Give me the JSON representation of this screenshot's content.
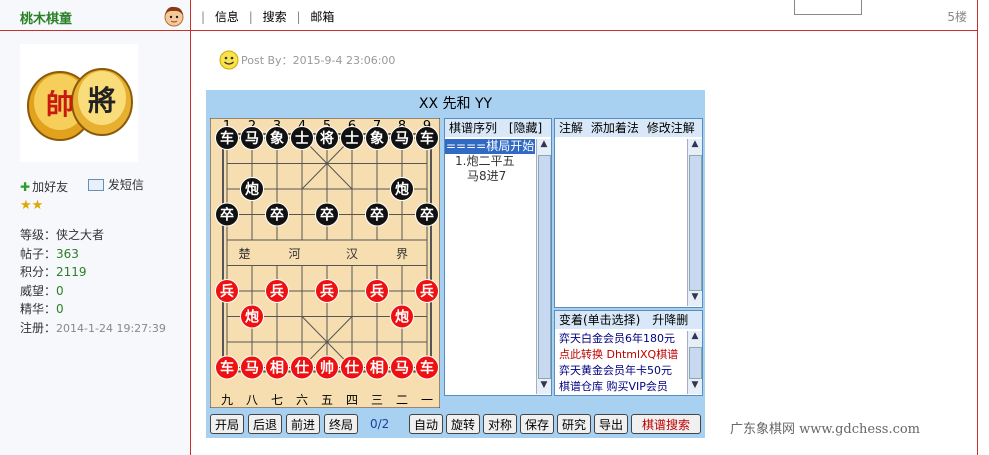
{
  "user": {
    "name": "桃木棋童",
    "add_friend": "加好友",
    "send_message": "发短信",
    "rows": [
      {
        "label": "等级：",
        "value": "侠之大者",
        "kind": "val"
      },
      {
        "label": "帖子：",
        "value": "363",
        "kind": "v"
      },
      {
        "label": "积分：",
        "value": "2119",
        "kind": "v"
      },
      {
        "label": "威望：",
        "value": "0",
        "kind": "v"
      },
      {
        "label": "精华：",
        "value": "0",
        "kind": "v"
      },
      {
        "label": "注册：",
        "value": "2014-1-24 19:27:39",
        "kind": "date"
      }
    ],
    "avatar_chars": [
      "帥",
      "將"
    ]
  },
  "menu": {
    "info": "信息",
    "search": "搜索",
    "mail": "邮箱",
    "sep": "|"
  },
  "floor": "5楼",
  "post": {
    "by": "Post By：2015-9-4 23:06:00"
  },
  "chess": {
    "title": "XX 先和 YY",
    "top_numbers": [
      "1",
      "2",
      "3",
      "4",
      "5",
      "6",
      "7",
      "8",
      "9"
    ],
    "bottom_numbers": [
      "九",
      "八",
      "七",
      "六",
      "五",
      "四",
      "三",
      "二",
      "一"
    ],
    "river": [
      "楚",
      "河",
      "汉",
      "界"
    ],
    "black_pieces": [
      {
        "c": "车",
        "col": 0,
        "row": 0
      },
      {
        "c": "马",
        "col": 1,
        "row": 0
      },
      {
        "c": "象",
        "col": 2,
        "row": 0
      },
      {
        "c": "士",
        "col": 3,
        "row": 0
      },
      {
        "c": "将",
        "col": 4,
        "row": 0
      },
      {
        "c": "士",
        "col": 5,
        "row": 0
      },
      {
        "c": "象",
        "col": 6,
        "row": 0
      },
      {
        "c": "马",
        "col": 7,
        "row": 0
      },
      {
        "c": "车",
        "col": 8,
        "row": 0
      },
      {
        "c": "炮",
        "col": 1,
        "row": 2
      },
      {
        "c": "炮",
        "col": 7,
        "row": 2
      },
      {
        "c": "卒",
        "col": 0,
        "row": 3
      },
      {
        "c": "卒",
        "col": 2,
        "row": 3
      },
      {
        "c": "卒",
        "col": 4,
        "row": 3
      },
      {
        "c": "卒",
        "col": 6,
        "row": 3
      },
      {
        "c": "卒",
        "col": 8,
        "row": 3
      }
    ],
    "red_pieces": [
      {
        "c": "兵",
        "col": 0,
        "row": 6
      },
      {
        "c": "兵",
        "col": 2,
        "row": 6
      },
      {
        "c": "兵",
        "col": 4,
        "row": 6
      },
      {
        "c": "兵",
        "col": 6,
        "row": 6
      },
      {
        "c": "兵",
        "col": 8,
        "row": 6
      },
      {
        "c": "炮",
        "col": 1,
        "row": 7
      },
      {
        "c": "炮",
        "col": 7,
        "row": 7
      },
      {
        "c": "车",
        "col": 0,
        "row": 9
      },
      {
        "c": "马",
        "col": 1,
        "row": 9
      },
      {
        "c": "相",
        "col": 2,
        "row": 9
      },
      {
        "c": "仕",
        "col": 3,
        "row": 9
      },
      {
        "c": "帅",
        "col": 4,
        "row": 9
      },
      {
        "c": "仕",
        "col": 5,
        "row": 9
      },
      {
        "c": "相",
        "col": 6,
        "row": 9
      },
      {
        "c": "马",
        "col": 7,
        "row": 9
      },
      {
        "c": "车",
        "col": 8,
        "row": 9
      }
    ],
    "moves_header": "棋谱序列",
    "moves_hide": "[隐藏]",
    "moves": [
      "====棋局开始",
      "1.炮二平五",
      "马8进7"
    ],
    "notes_header": [
      "注解",
      "添加着法",
      "修改注解"
    ],
    "variations_header": "变着(单击选择)",
    "variations_sort": "升降删",
    "variations": [
      {
        "text": "弈天白金会员6年180元",
        "color": "#000080"
      },
      {
        "text": "点此转换 DhtmlXQ棋谱",
        "color": "#c00000"
      },
      {
        "text": "弈天黄金会员年卡50元",
        "color": "#000080"
      },
      {
        "text": "棋谱仓库 购买VIP会员",
        "color": "#000080"
      }
    ],
    "buttons": [
      "开局",
      "后退",
      "前进",
      "终局",
      "自动",
      "旋转",
      "对称",
      "保存",
      "研究",
      "导出",
      "棋谱搜索"
    ],
    "step": "0/2",
    "colors": {
      "board": "#f6deb0",
      "red": "#ee1111",
      "black": "#111111",
      "frame": "#a8d0f0"
    }
  },
  "watermark": "广东象棋网  www.gdchess.com"
}
